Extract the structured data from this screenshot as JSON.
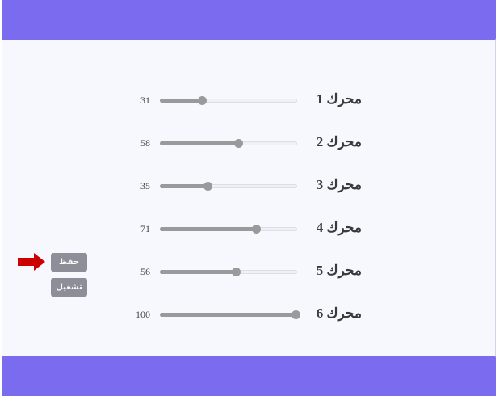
{
  "motors": [
    {
      "label": "محرك 1",
      "value": "31",
      "level": 0.31
    },
    {
      "label": "محرك 2",
      "value": "58",
      "level": 0.58
    },
    {
      "label": "محرك 3",
      "value": "35",
      "level": 0.35
    },
    {
      "label": "محرك 4",
      "value": "71",
      "level": 0.71
    },
    {
      "label": "محرك 5",
      "value": "56",
      "level": 0.56
    },
    {
      "label": "محرك 6",
      "value": "100",
      "level": 1.0
    }
  ],
  "actions": {
    "save_label": "حفظ",
    "run_label": "تشغيل"
  },
  "icons": {
    "pointer": "arrow-right-icon"
  },
  "colors": {
    "header": "#7b6bef",
    "footer": "#7b6bef",
    "background": "#f7f8fe",
    "slider_fill": "#9a9a9c",
    "button": "#8d8f98",
    "arrow": "#cc0000"
  }
}
